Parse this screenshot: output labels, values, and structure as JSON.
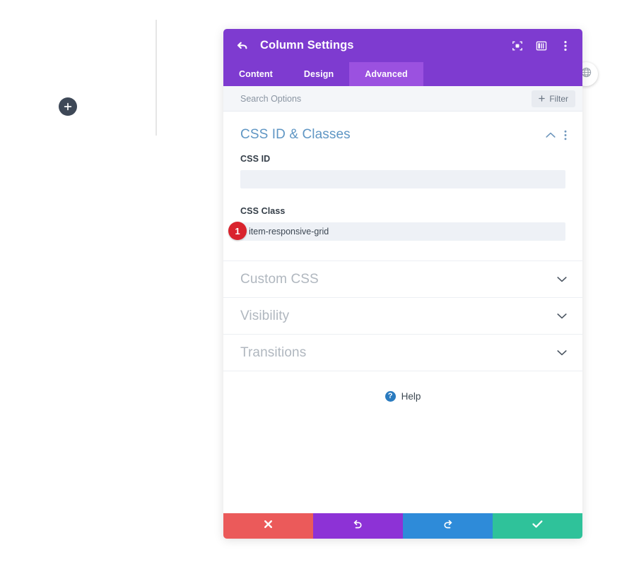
{
  "builder": {
    "add_button_icon": "plus-icon",
    "globe_button_icon": "globe-icon",
    "divider_name": "column-divider"
  },
  "modal": {
    "title": "Column Settings",
    "back_icon": "back-arrow-icon",
    "header_actions": [
      {
        "name": "focus-target-icon",
        "label": ""
      },
      {
        "name": "layout-columns-icon",
        "label": ""
      },
      {
        "name": "vertical-dots-icon",
        "label": ""
      }
    ],
    "tabs": [
      {
        "label": "Content",
        "active": false
      },
      {
        "label": "Design",
        "active": false
      },
      {
        "label": "Advanced",
        "active": true
      }
    ],
    "search": {
      "placeholder": "Search Options",
      "value": ""
    },
    "filter_button": {
      "label": "Filter",
      "icon": "plus-icon"
    },
    "sections": [
      {
        "title": "CSS ID & Classes",
        "state": "expanded",
        "toggle_icon": "chevron-up-icon",
        "menu_icon": "vertical-dots-icon",
        "fields": [
          {
            "label": "CSS ID",
            "value": "",
            "badge": ""
          },
          {
            "label": "CSS Class",
            "value": "item-responsive-grid",
            "badge": "1"
          }
        ]
      },
      {
        "title": "Custom CSS",
        "state": "collapsed",
        "toggle_icon": "chevron-down-icon"
      },
      {
        "title": "Visibility",
        "state": "collapsed",
        "toggle_icon": "chevron-down-icon"
      },
      {
        "title": "Transitions",
        "state": "collapsed",
        "toggle_icon": "chevron-down-icon"
      }
    ],
    "help": {
      "label": "Help",
      "icon": "question-mark-icon"
    },
    "footer_buttons": [
      {
        "name": "cancel-button",
        "icon": "close-x-icon",
        "color": "#eb5a5a"
      },
      {
        "name": "undo-button",
        "icon": "undo-arrow-icon",
        "color": "#8d32d6"
      },
      {
        "name": "redo-button",
        "icon": "redo-arrow-icon",
        "color": "#2e8bd9"
      },
      {
        "name": "save-button",
        "icon": "checkmark-icon",
        "color": "#2fc29a"
      }
    ]
  },
  "colors": {
    "header_purple": "#7e3bd0",
    "tab_active_purple": "#9b51e0",
    "badge_red": "#d9232d",
    "section_heading_blue": "#5f96c4",
    "help_blue": "#2a7bbf"
  }
}
